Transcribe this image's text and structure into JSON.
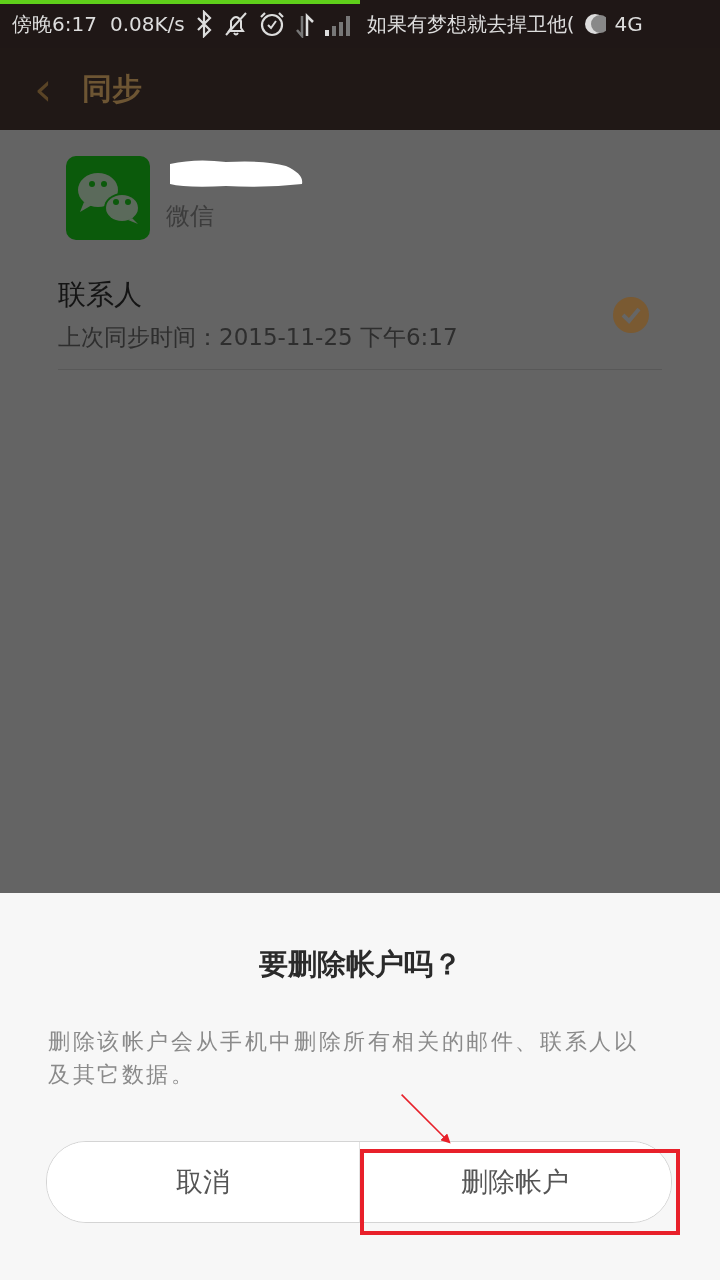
{
  "status_bar": {
    "level": 0.5,
    "time": "傍晚6:17",
    "speed": "0.08K/s",
    "carrier": "如果有梦想就去捍卫他(",
    "network": "4G"
  },
  "header": {
    "back": "‹",
    "title": "同步"
  },
  "account": {
    "type": "微信"
  },
  "sync_items": [
    {
      "label": "联系人",
      "detail": "上次同步时间：2015-11-25 下午6:17",
      "checked": true
    }
  ],
  "dialog": {
    "title": "要删除帐户吗？",
    "message": "删除该帐户会从手机中删除所有相关的邮件、联系人以及其它数据。",
    "buttons": [
      {
        "label": "取消",
        "kind": "cancel"
      },
      {
        "label": "删除帐户",
        "kind": "confirm"
      }
    ]
  }
}
